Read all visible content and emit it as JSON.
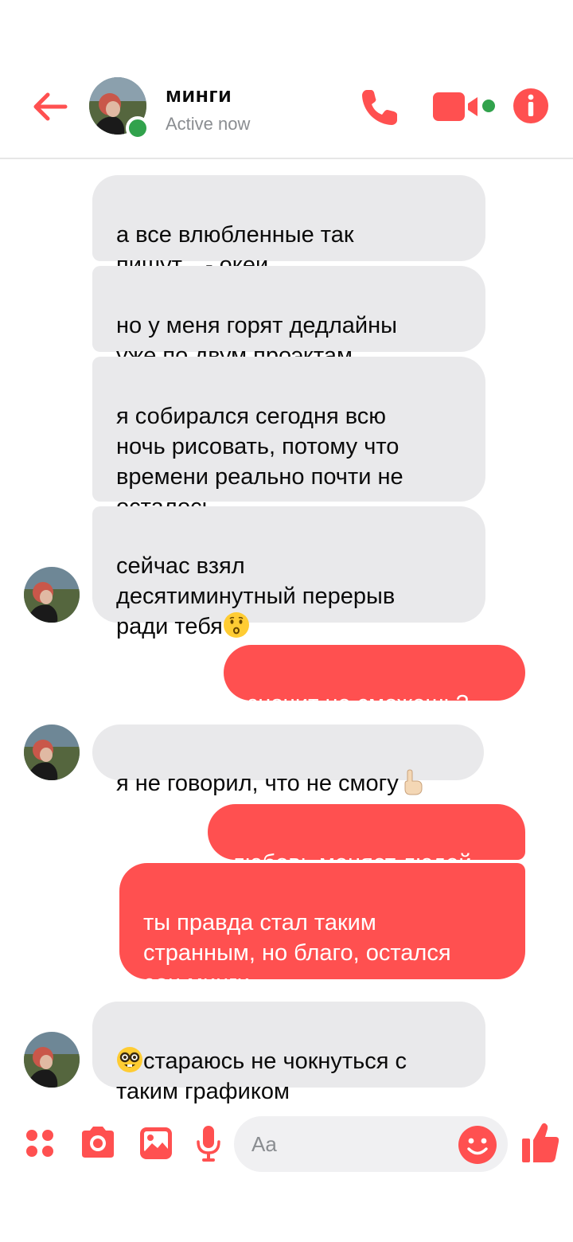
{
  "header": {
    "contact_name": "минги",
    "status": "Active now"
  },
  "messages": [
    {
      "side": "in",
      "text": "а все влюбленные так\nпишут... - океи"
    },
    {
      "side": "in",
      "text": "но у меня горят дедлайны\nуже по двум проэктам"
    },
    {
      "side": "in",
      "text": "я собирался сегодня всю\nночь рисовать, потому что\nвремени реально почти не\nосталось"
    },
    {
      "side": "in",
      "text": "сейчас взял\nдесятиминутный перерыв\nради тебя",
      "emoji": "kissing-face"
    },
    {
      "side": "out",
      "text": "значит не сможешь?"
    },
    {
      "side": "in",
      "text": "я не говорил, что не смогу",
      "emoji": "index-pointing-up"
    },
    {
      "side": "out",
      "text": "любовь меняет людей"
    },
    {
      "side": "out",
      "text": "ты правда стал таким\nстранным, но благо, остался\nсон минги"
    },
    {
      "side": "in",
      "text_line1": "стараюсь не чокнуться с",
      "text_line2": "таким графиком",
      "emoji": "nerd-face"
    }
  ],
  "composer": {
    "placeholder": "Aa"
  },
  "colors": {
    "accent": "#ff5050",
    "incoming_bubble": "#e9e9eb",
    "online": "#31a24c"
  }
}
